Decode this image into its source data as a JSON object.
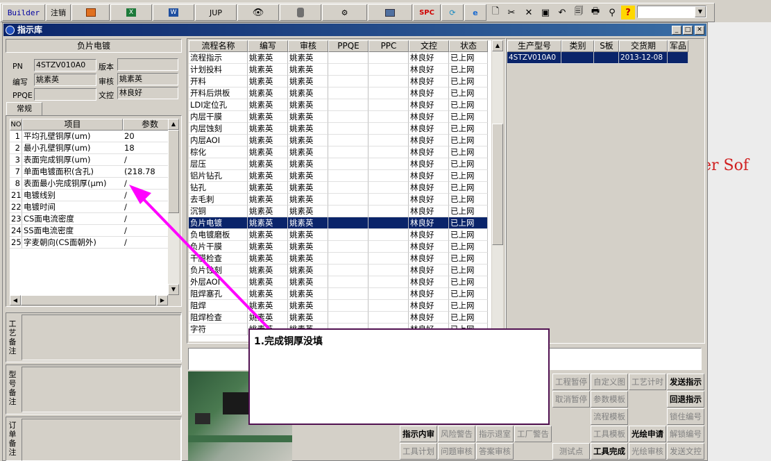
{
  "toolbar": {
    "builder": "Builder",
    "logout": "注销",
    "jup": "JUP",
    "spc": "SPC",
    "help": "?"
  },
  "window": {
    "title": "指示库"
  },
  "left": {
    "section_title": "负片电镀",
    "pn_label": "PN",
    "pn_value": "4STZV010A0",
    "version_label": "版本",
    "version_value": "",
    "author_label": "编写",
    "author_value": "姚素英",
    "review_label": "审核",
    "review_value": "姚素英",
    "ppqe_label": "PPQE",
    "ppqe_value": "",
    "doc_label": "文控",
    "doc_value": "林良好",
    "tab": "常规",
    "param_headers": [
      "NO",
      "项目",
      "参数"
    ],
    "params": [
      {
        "no": "1",
        "item": "平均孔壁铜厚(um)",
        "val": "20"
      },
      {
        "no": "2",
        "item": "最小孔壁铜厚(um)",
        "val": "18"
      },
      {
        "no": "3",
        "item": "表面完成铜厚(um)",
        "val": "/"
      },
      {
        "no": "7",
        "item": "单面电镀面积(含孔)",
        "val": "(218.78"
      },
      {
        "no": "8",
        "item": "表面最小完成铜厚(μm)",
        "val": "/"
      },
      {
        "no": "21",
        "item": "电镀线别",
        "val": "/"
      },
      {
        "no": "22",
        "item": "电镀时间",
        "val": "/"
      },
      {
        "no": "23",
        "item": "CS面电流密度",
        "val": "/"
      },
      {
        "no": "24",
        "item": "SS面电流密度",
        "val": "/"
      },
      {
        "no": "25",
        "item": "字麦朝向(CS面朝外)",
        "val": "/"
      }
    ],
    "notes": [
      "工艺备注",
      "型号备注",
      "订单备注"
    ]
  },
  "process_table": {
    "headers": [
      "流程名称",
      "编写",
      "审核",
      "PPQE",
      "PPC",
      "文控",
      "状态"
    ],
    "rows": [
      [
        "流程指示",
        "姚素英",
        "姚素英",
        "",
        "",
        "林良好",
        "已上网"
      ],
      [
        "计划投料",
        "姚素英",
        "姚素英",
        "",
        "",
        "林良好",
        "已上网"
      ],
      [
        "开料",
        "姚素英",
        "姚素英",
        "",
        "",
        "林良好",
        "已上网"
      ],
      [
        "开料后烘板",
        "姚素英",
        "姚素英",
        "",
        "",
        "林良好",
        "已上网"
      ],
      [
        "LDI定位孔",
        "姚素英",
        "姚素英",
        "",
        "",
        "林良好",
        "已上网"
      ],
      [
        "内层干膜",
        "姚素英",
        "姚素英",
        "",
        "",
        "林良好",
        "已上网"
      ],
      [
        "内层蚀刻",
        "姚素英",
        "姚素英",
        "",
        "",
        "林良好",
        "已上网"
      ],
      [
        "内层AOI",
        "姚素英",
        "姚素英",
        "",
        "",
        "林良好",
        "已上网"
      ],
      [
        "棕化",
        "姚素英",
        "姚素英",
        "",
        "",
        "林良好",
        "已上网"
      ],
      [
        "层压",
        "姚素英",
        "姚素英",
        "",
        "",
        "林良好",
        "已上网"
      ],
      [
        "铝片钻孔",
        "姚素英",
        "姚素英",
        "",
        "",
        "林良好",
        "已上网"
      ],
      [
        "钻孔",
        "姚素英",
        "姚素英",
        "",
        "",
        "林良好",
        "已上网"
      ],
      [
        "去毛刺",
        "姚素英",
        "姚素英",
        "",
        "",
        "林良好",
        "已上网"
      ],
      [
        "沉铜",
        "姚素英",
        "姚素英",
        "",
        "",
        "林良好",
        "已上网"
      ],
      [
        "负片电镀",
        "姚素英",
        "姚素英",
        "",
        "",
        "林良好",
        "已上网"
      ],
      [
        "负电镀磨板",
        "姚素英",
        "姚素英",
        "",
        "",
        "林良好",
        "已上网"
      ],
      [
        "负片干膜",
        "姚素英",
        "姚素英",
        "",
        "",
        "林良好",
        "已上网"
      ],
      [
        "干膜检查",
        "姚素英",
        "姚素英",
        "",
        "",
        "林良好",
        "已上网"
      ],
      [
        "负片蚀刻",
        "姚素英",
        "姚素英",
        "",
        "",
        "林良好",
        "已上网"
      ],
      [
        "外层AOI",
        "姚素英",
        "姚素英",
        "",
        "",
        "林良好",
        "已上网"
      ],
      [
        "阻焊塞孔",
        "姚素英",
        "姚素英",
        "",
        "",
        "林良好",
        "已上网"
      ],
      [
        "阻焊",
        "姚素英",
        "姚素英",
        "",
        "",
        "林良好",
        "已上网"
      ],
      [
        "阻焊检查",
        "姚素英",
        "姚素英",
        "",
        "",
        "林良好",
        "已上网"
      ],
      [
        "字符",
        "姚素英",
        "姚素英",
        "",
        "",
        "林良好",
        "已上网"
      ]
    ],
    "selected_index": 14
  },
  "model_table": {
    "headers": [
      "生产型号",
      "类别",
      "S板",
      "交货期",
      "军品"
    ],
    "rows": [
      [
        "4STZV010A0",
        "",
        "",
        "2013-12-08",
        ""
      ]
    ]
  },
  "background_text": "er Sof",
  "buttons": {
    "row1": [
      "工程暂停",
      "自定义图",
      "工艺计时",
      "发送指示"
    ],
    "row2": [
      "取消暂停",
      "参数模板",
      "回退指示"
    ],
    "row3": [
      "流程模板",
      "锁住编号"
    ],
    "row4": [
      "指示内审",
      "风险警告",
      "指示退室",
      "工厂警告",
      "工具模板",
      "光绘申请",
      "解锁编号"
    ],
    "row5": [
      "工具计划",
      "问题审核",
      "答案审核",
      "测试点",
      "工具完成",
      "光绘审核",
      "发送文控"
    ]
  },
  "annotation": {
    "text": "1.完成铜厚没填",
    "color": "#ff00ff"
  }
}
